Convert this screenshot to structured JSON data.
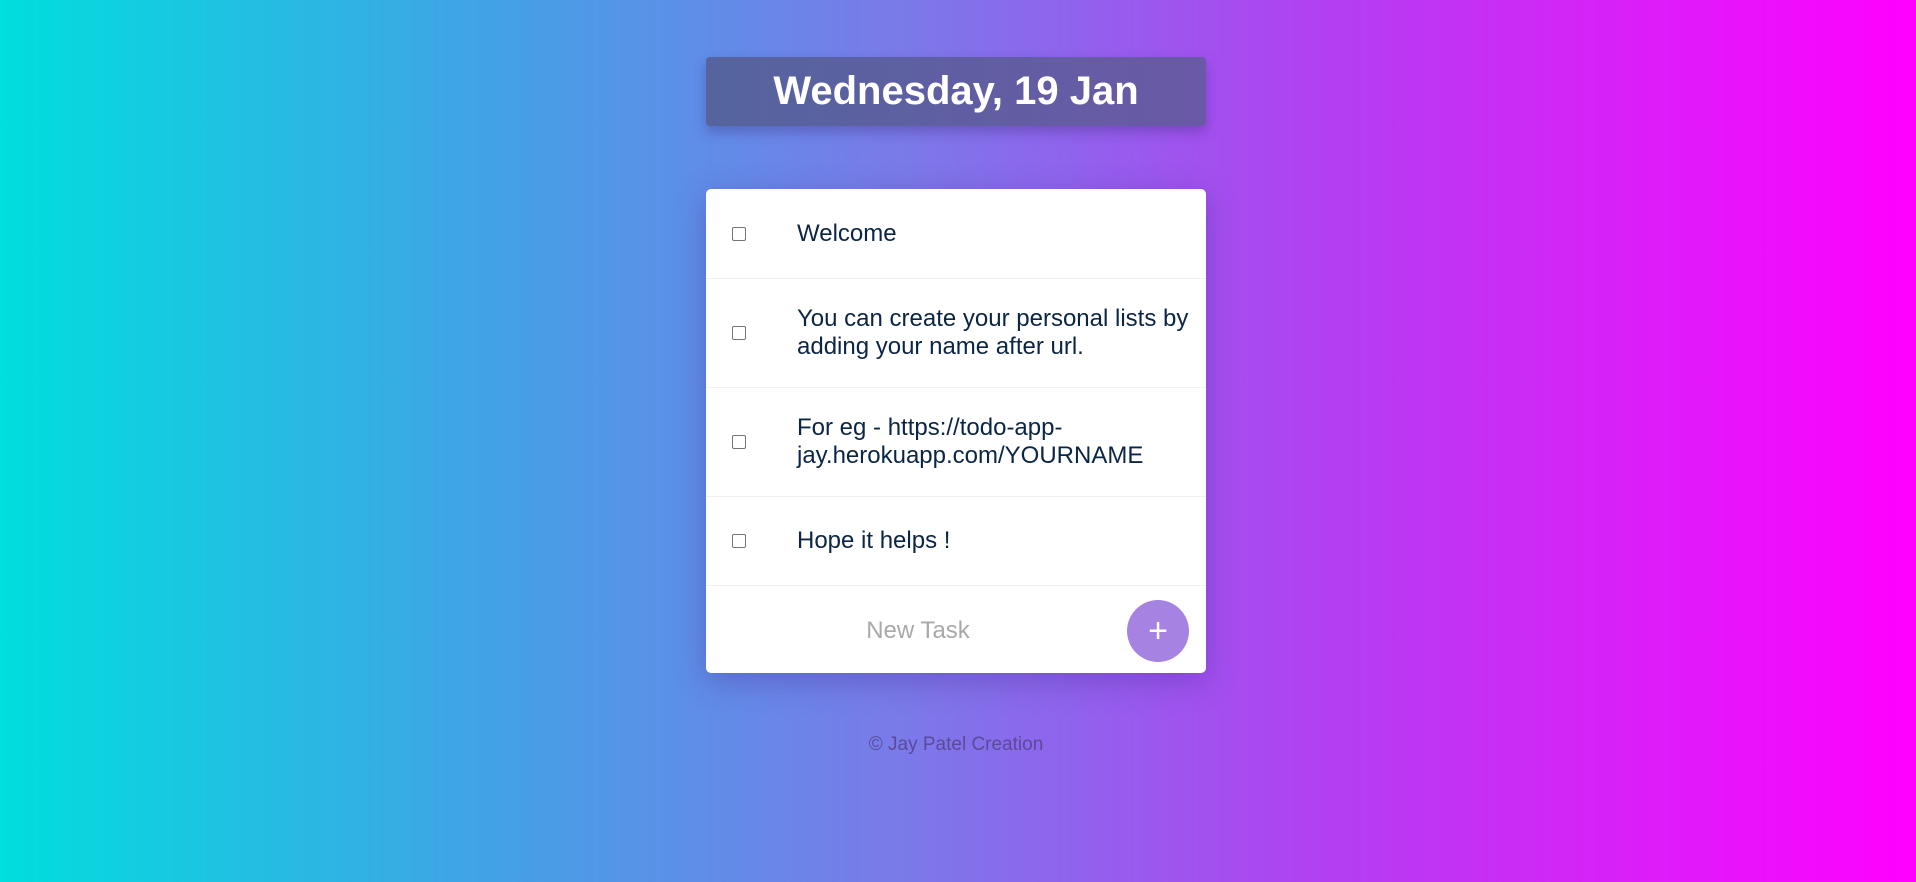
{
  "header": {
    "date": "Wednesday, 19 Jan"
  },
  "tasks": [
    {
      "text": "Welcome",
      "checked": false
    },
    {
      "text": "You can create your personal lists by adding your name after url.",
      "checked": false
    },
    {
      "text": "For eg - https://todo-app-jay.herokuapp.com/YOURNAME",
      "checked": false
    },
    {
      "text": "Hope it helps !",
      "checked": false
    }
  ],
  "new_task": {
    "placeholder": "New Task",
    "value": "",
    "add_label": "+"
  },
  "footer": {
    "text": "© Jay Patel Creation"
  },
  "colors": {
    "add_button": "#a683e3",
    "task_text": "#0b2545",
    "date_box": "#5f5fa3"
  }
}
